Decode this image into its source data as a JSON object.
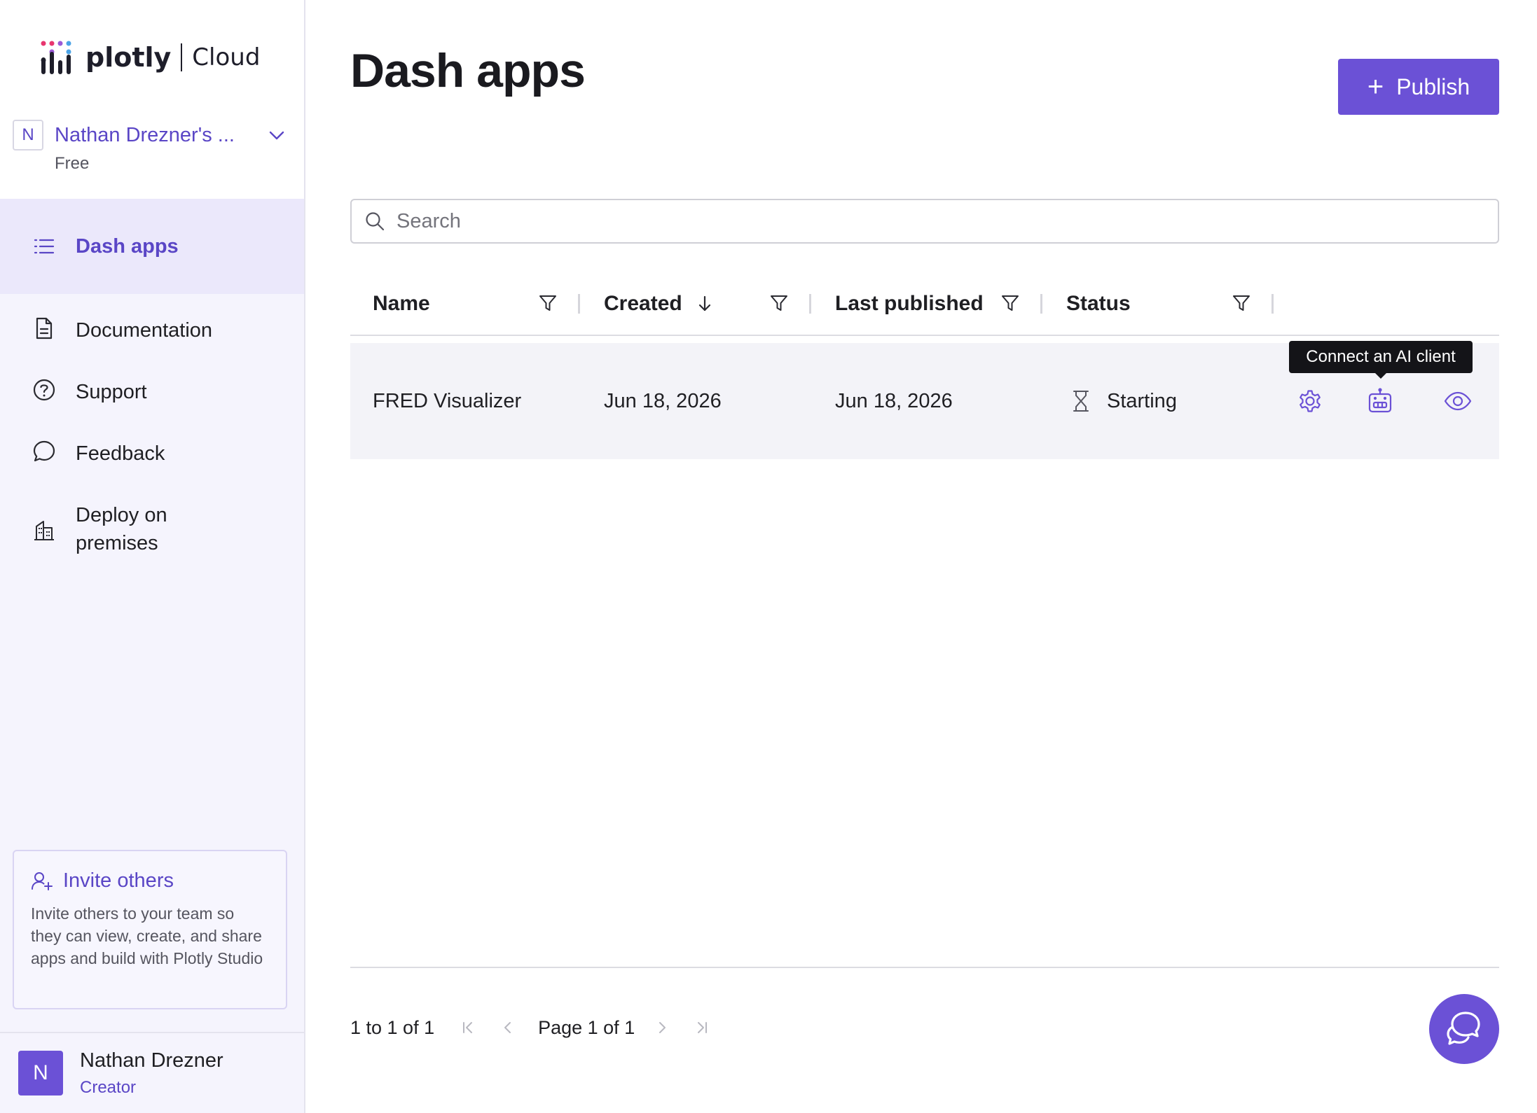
{
  "app": {
    "brand": "plotly",
    "product": "Cloud"
  },
  "team": {
    "initial": "N",
    "name": "Nathan Drezner's ...",
    "plan": "Free"
  },
  "sidebar": {
    "items": [
      {
        "label": "Dash apps",
        "icon": "list-icon",
        "active": true
      },
      {
        "label": "Documentation",
        "icon": "document-icon"
      },
      {
        "label": "Support",
        "icon": "help-circle-icon"
      },
      {
        "label": "Feedback",
        "icon": "chat-bubble-icon"
      },
      {
        "label": "Deploy on premises",
        "icon": "building-icon"
      }
    ]
  },
  "invite": {
    "title": "Invite others",
    "text": "Invite others to your team so they can view, create, and share apps and build with Plotly Studio"
  },
  "user": {
    "initial": "N",
    "name": "Nathan Drezner",
    "role": "Creator"
  },
  "main": {
    "title": "Dash apps",
    "publish_label": "Publish",
    "search_placeholder": "Search"
  },
  "table": {
    "columns": [
      {
        "label": "Name"
      },
      {
        "label": "Created",
        "sort": "descending"
      },
      {
        "label": "Last published"
      },
      {
        "label": "Status"
      }
    ],
    "rows": [
      {
        "name": "FRED Visualizer",
        "created": "Jun 18, 2026",
        "last_published": "Jun 18, 2026",
        "status": "Starting",
        "status_icon": "hourglass-icon",
        "actions": [
          "settings-icon",
          "robot-icon",
          "eye-icon"
        ]
      }
    ]
  },
  "tooltip": {
    "text": "Connect an AI client"
  },
  "pagination": {
    "summary": "1 to 1 of 1",
    "page_text": "Page 1 of 1"
  },
  "colors": {
    "accent": "#6b51d6",
    "accent_text": "#5a46c6",
    "sidebar_bg": "#f5f4fd",
    "active_nav_bg": "#ebe8fb",
    "row_bg": "#f3f3f8"
  }
}
